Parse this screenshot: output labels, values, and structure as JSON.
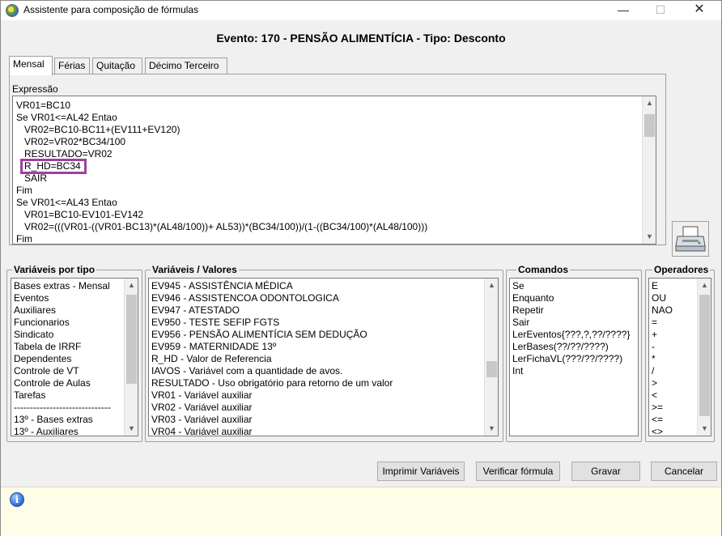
{
  "window": {
    "title": "Assistente para composição de fórmulas",
    "minimize": "—",
    "maximize": "☐",
    "close": "✕"
  },
  "header": {
    "title": "Evento: 170 - PENSÃO ALIMENTÍCIA - Tipo: Desconto"
  },
  "tabs": [
    {
      "label": "Mensal",
      "active": true
    },
    {
      "label": "Férias",
      "active": false
    },
    {
      "label": "Quitação",
      "active": false
    },
    {
      "label": "Décimo Terceiro",
      "active": false
    }
  ],
  "expression": {
    "label": "Expressão",
    "lines": [
      "VR01=BC10",
      "Se VR01<=AL42 Entao",
      "   VR02=BC10-BC11+(EV111+EV120)",
      "   VR02=VR02*BC34/100",
      "   RESULTADO=VR02",
      "   R_HD=BC34",
      "   SAIR",
      "Fim",
      "Se VR01<=AL43 Entao",
      "   VR01=BC10-EV101-EV142",
      "   VR02=(((VR01-((VR01-BC13)*(AL48/100))+ AL53))*(BC34/100))/(1-((BC34/100)*(AL48/100)))",
      "Fim"
    ],
    "highlighted_line": "R_HD=BC34"
  },
  "variaveis_por_tipo": {
    "title": "Variáveis por tipo",
    "items": [
      "Bases extras - Mensal",
      "Eventos",
      "Auxiliares",
      "Funcionarios",
      "Sindicato",
      "Tabela de IRRF",
      "Dependentes",
      "Controle de VT",
      "Controle de Aulas",
      "Tarefas",
      "------------------------------",
      "13º - Bases extras",
      "13º - Auxiliares"
    ]
  },
  "variaveis_valores": {
    "title": "Variáveis / Valores",
    "items": [
      "EV945 - ASSISTÊNCIA MÉDICA",
      "EV946 - ASSISTENCOA ODONTOLOGICA",
      "EV947 - ATESTADO",
      "EV950 - TESTE SEFIP FGTS",
      "EV956 - PENSÃO ALIMENTÍCIA SEM DEDUÇÃO",
      "EV959 - MATERNIDADE 13º",
      "R_HD - Valor de Referencia",
      "IAVOS - Variável com a quantidade de avos.",
      "RESULTADO - Uso obrigatório para retorno de um valor",
      "VR01 - Variável auxiliar",
      "VR02 - Variável auxiliar",
      "VR03 - Variável auxiliar",
      "VR04 - Variável auxiliar"
    ]
  },
  "comandos": {
    "title": "Comandos",
    "items": [
      "Se",
      "Enquanto",
      "Repetir",
      "Sair",
      "LerEventos{???,?,??/????}",
      "LerBases(??/??/????)",
      "LerFichaVL(???/??/????)",
      "Int"
    ]
  },
  "operadores": {
    "title": "Operadores",
    "items": [
      "E",
      "OU",
      "NAO",
      "=",
      "+",
      "-",
      "*",
      "/",
      ">",
      "<",
      ">=",
      "<=",
      "<>"
    ]
  },
  "buttons": {
    "imprimir": "Imprimir Variáveis",
    "verificar": "Verificar fórmula",
    "gravar": "Gravar",
    "cancelar": "Cancelar"
  },
  "colors": {
    "highlight_border": "#a040a0",
    "status_bg": "#fefee8"
  }
}
